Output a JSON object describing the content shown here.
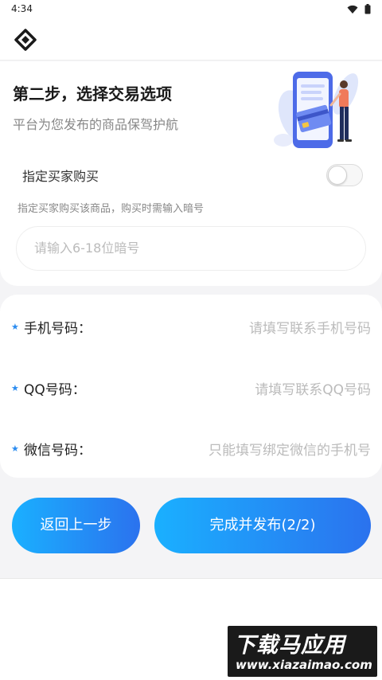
{
  "status_bar": {
    "time": "4:34"
  },
  "header": {
    "logo_icon": "diamond-logo-icon"
  },
  "step": {
    "title": "第二步，选择交易选项",
    "subtitle": "平台为您发布的商品保驾护航"
  },
  "buyer": {
    "toggle_label": "指定买家购买",
    "toggle_on": false,
    "description": "指定买家购买该商品，购买时需输入暗号",
    "code_placeholder": "请输入6-18位暗号"
  },
  "contact": {
    "fields": [
      {
        "label": "手机号码：",
        "placeholder": "请填写联系手机号码"
      },
      {
        "label": "QQ号码：",
        "placeholder": "请填写联系QQ号码"
      },
      {
        "label": "微信号码：",
        "placeholder": "只能填写绑定微信的手机号"
      }
    ]
  },
  "actions": {
    "back_label": "返回上一步",
    "submit_label": "完成并发布(2/2)"
  },
  "watermark": {
    "title": "下载马应用",
    "url": "www.xiazaimao.com"
  },
  "colors": {
    "accent": "#2b8cf0",
    "button_start": "#1ab0ff",
    "button_end": "#2b72ee"
  }
}
